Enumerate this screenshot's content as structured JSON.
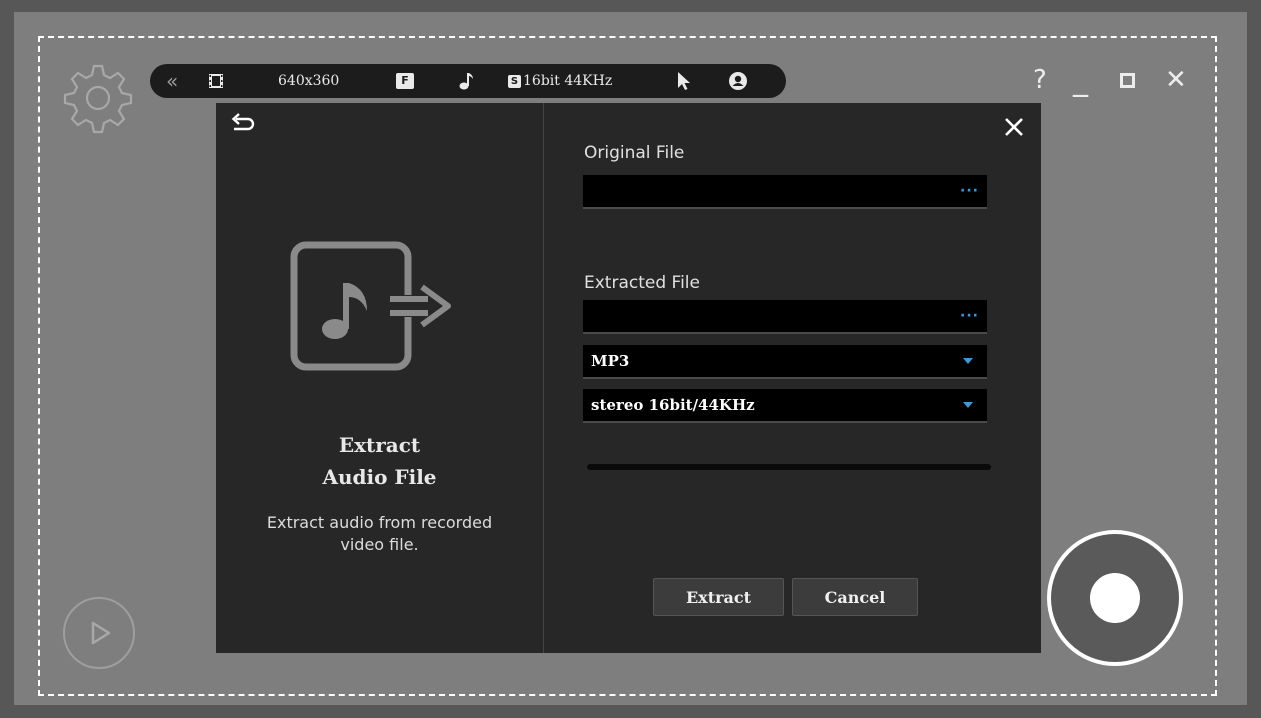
{
  "toolbar": {
    "collapse_label": "«",
    "resolution": "640x360",
    "frame_badge": "F",
    "audio_format": "16bit 44KHz",
    "audio_badge": "S"
  },
  "window_controls": {
    "help": "?",
    "minimize": "_",
    "close": "✕"
  },
  "dialog": {
    "left": {
      "title_line1": "Extract",
      "title_line2": "Audio File",
      "description_line1": "Extract audio from recorded",
      "description_line2": "video file."
    },
    "right": {
      "original_label": "Original File",
      "original_value": "",
      "browse_dots": "···",
      "extracted_label": "Extracted File",
      "extracted_value": "",
      "format_selected": "MP3",
      "quality_selected": "stereo 16bit/44KHz",
      "progress": 0,
      "extract_button": "Extract",
      "cancel_button": "Cancel"
    }
  },
  "colors": {
    "accent": "#3a9ad9",
    "dialog_bg": "#272727",
    "canvas_bg": "#7e7e7e"
  }
}
